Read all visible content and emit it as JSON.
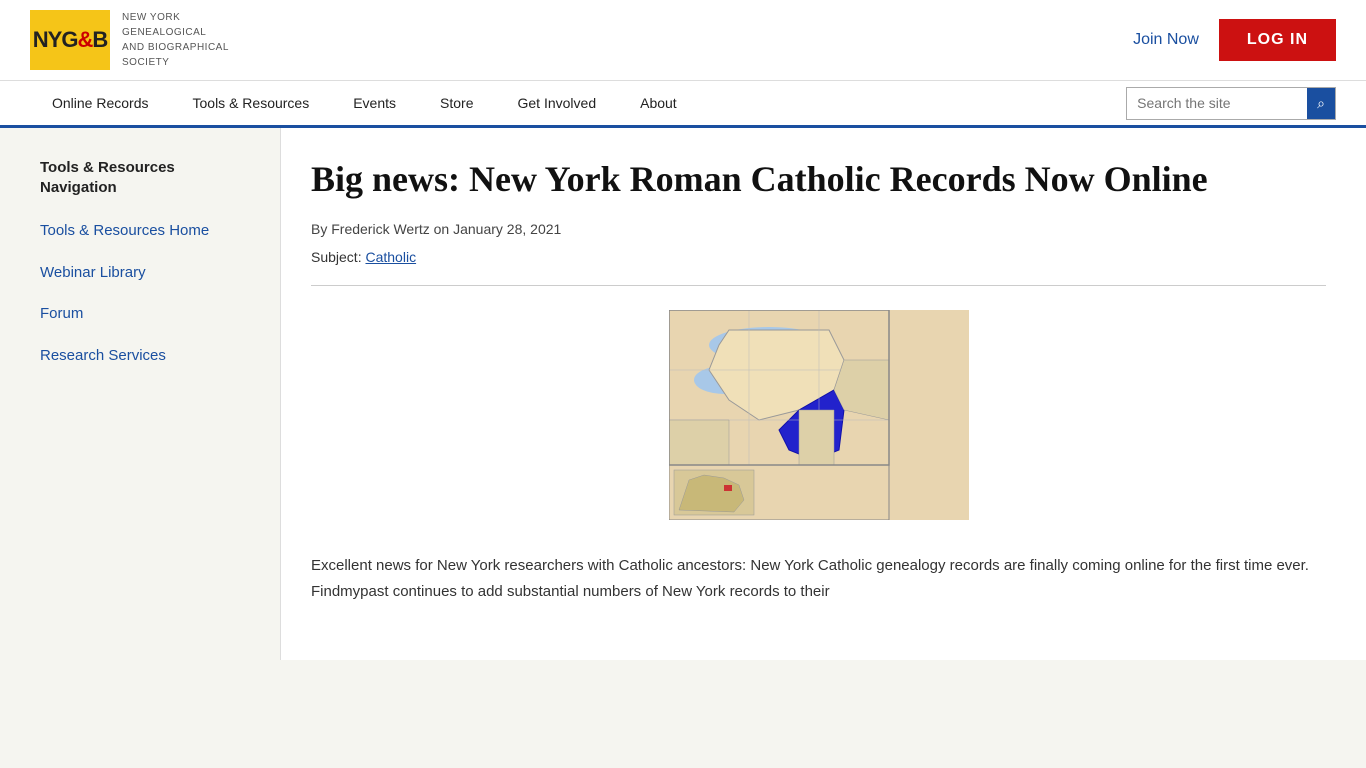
{
  "header": {
    "logo_text": "NYG&B",
    "logo_ampersand": "&",
    "org_line1": "NEW YORK",
    "org_line2": "GENEALOGICAL",
    "org_line3": "AND BIOGRAPHICAL",
    "org_line4": "SOCIETY",
    "join_now": "Join Now",
    "login_btn": "LOG IN"
  },
  "nav": {
    "items": [
      {
        "label": "Online Records"
      },
      {
        "label": "Tools & Resources"
      },
      {
        "label": "Events"
      },
      {
        "label": "Store"
      },
      {
        "label": "Get Involved"
      },
      {
        "label": "About"
      }
    ],
    "search_placeholder": "Search the site"
  },
  "sidebar": {
    "nav_title": "Tools & Resources Navigation",
    "links": [
      {
        "label": "Tools & Resources Home"
      },
      {
        "label": "Webinar Library"
      },
      {
        "label": "Forum"
      },
      {
        "label": "Research Services"
      }
    ]
  },
  "article": {
    "title": "Big news: New York Roman Catholic Records Now Online",
    "meta": "By Frederick Wertz on January 28, 2021",
    "subject_label": "Subject:",
    "subject_link": "Catholic",
    "body_p1": "Excellent news for New York researchers with Catholic ancestors: New York Catholic genealogy records are finally coming online for the first time ever. Findmypast continues to add substantial numbers of New York records to their",
    "body_p1_suffix": ""
  }
}
